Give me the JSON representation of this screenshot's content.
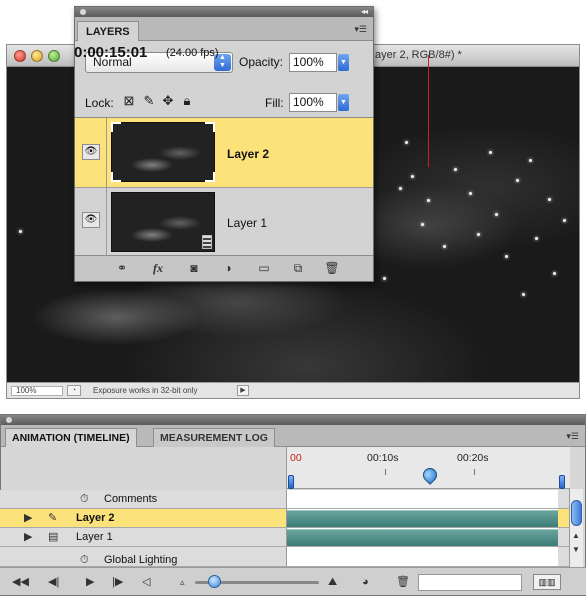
{
  "document": {
    "title": "ayer 2, RGB/8#) *",
    "zoom": "100%",
    "status_text": "Exposure works in 32-bit only"
  },
  "layers_panel": {
    "tab_label": "LAYERS",
    "blend_mode": "Normal",
    "opacity_label": "Opacity:",
    "opacity_value": "100%",
    "lock_label": "Lock:",
    "fill_label": "Fill:",
    "fill_value": "100%",
    "layers": [
      {
        "name": "Layer 2",
        "selected": true,
        "visible": true
      },
      {
        "name": "Layer 1",
        "selected": false,
        "visible": true
      }
    ],
    "footer_icons": [
      "link-icon",
      "fx-icon",
      "mask-icon",
      "adjustment-icon",
      "folder-icon",
      "new-layer-icon",
      "trash-icon"
    ],
    "fx_label": "fx"
  },
  "timeline": {
    "tabs": [
      "ANIMATION (TIMELINE)",
      "MEASUREMENT LOG"
    ],
    "current_time": "0:00:15:01",
    "fps": "(24.00 fps)",
    "ruler_labels": [
      "00",
      "00:10s",
      "00:20s"
    ],
    "rows": [
      {
        "label": "Comments",
        "icon": "stopwatch-icon",
        "has_bar": false,
        "selected": false
      },
      {
        "label": "Layer 2",
        "icon": "brush-icon",
        "has_bar": true,
        "selected": true
      },
      {
        "label": "Layer 1",
        "icon": "film-icon",
        "has_bar": true,
        "selected": false
      },
      {
        "label": "Global Lighting",
        "icon": "stopwatch-icon",
        "has_bar": false,
        "selected": false
      }
    ],
    "colors": {
      "selection": "#fbe27a",
      "track_bar": "#3b7d76",
      "playhead": "#c8201e",
      "ruler_start_label": "#c8201e"
    }
  }
}
